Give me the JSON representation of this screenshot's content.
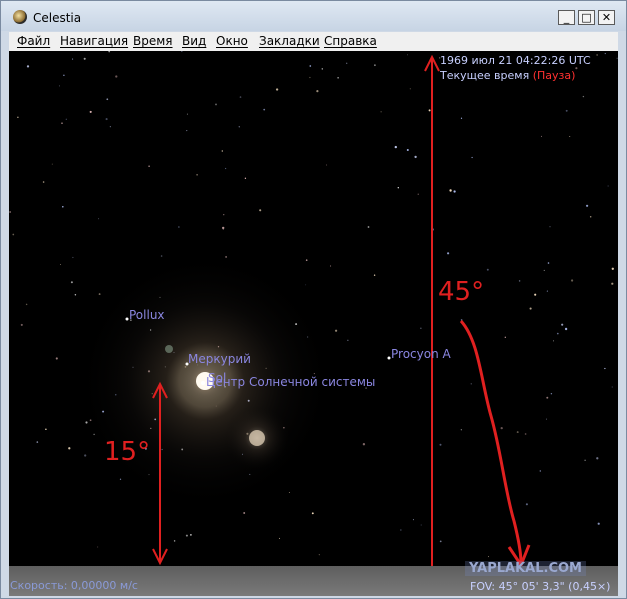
{
  "window": {
    "title": "Celestia",
    "minimize_glyph": "_",
    "maximize_glyph": "□",
    "close_glyph": "✕"
  },
  "menu": {
    "items": [
      "Файл",
      "Навигация",
      "Время",
      "Вид",
      "Окно",
      "Закладки",
      "Справка"
    ]
  },
  "overlay": {
    "datetime": "1969 июл 21 04:22:26 UTC",
    "time_label": "Текущее время",
    "pause": "(Пауза)",
    "speed": "Скорость: 0,00000 м/с",
    "fov": "FOV: 45° 05' 3,3\" (0,45×)",
    "watermark": "YAPLAKAL.COM"
  },
  "labels": {
    "pollux": "Pollux",
    "mercury": "Меркурий",
    "sol": "Sol",
    "solar_center": "Центр Солнечной системы",
    "procyon": "Procyon A"
  },
  "annotations": {
    "angle_large": "45°",
    "angle_small": "15°"
  },
  "colors": {
    "label": "#8a86e0",
    "overlay_text": "#c8d0ff",
    "pause": "#ff3030",
    "annotation": "#e02020",
    "sky": "#000000"
  }
}
